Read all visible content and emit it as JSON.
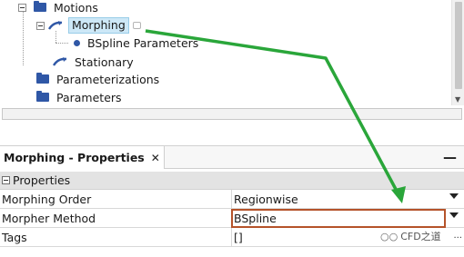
{
  "tree": {
    "items": [
      {
        "label": "Motions"
      },
      {
        "label": "Morphing"
      },
      {
        "label": "BSpline Parameters"
      },
      {
        "label": "Stationary"
      },
      {
        "label": "Parameterizations"
      },
      {
        "label": "Parameters"
      }
    ]
  },
  "properties": {
    "title": "Morphing - Properties",
    "close_glyph": "✕",
    "minimize_glyph": "—",
    "group_label": "Properties",
    "rows": [
      {
        "name": "Morphing Order",
        "value": "Regionwise"
      },
      {
        "name": "Morpher Method",
        "value": "BSpline"
      },
      {
        "name": "Tags",
        "value": "[]"
      }
    ],
    "ellipsis": "..."
  },
  "watermark": {
    "icon": "chat-bubbles-icon",
    "text": "CFD之道"
  },
  "colors": {
    "arrow": "#2aa63a",
    "highlight_border": "#b5532a",
    "folder": "#2f57a6",
    "selection": "#cde8f7"
  }
}
